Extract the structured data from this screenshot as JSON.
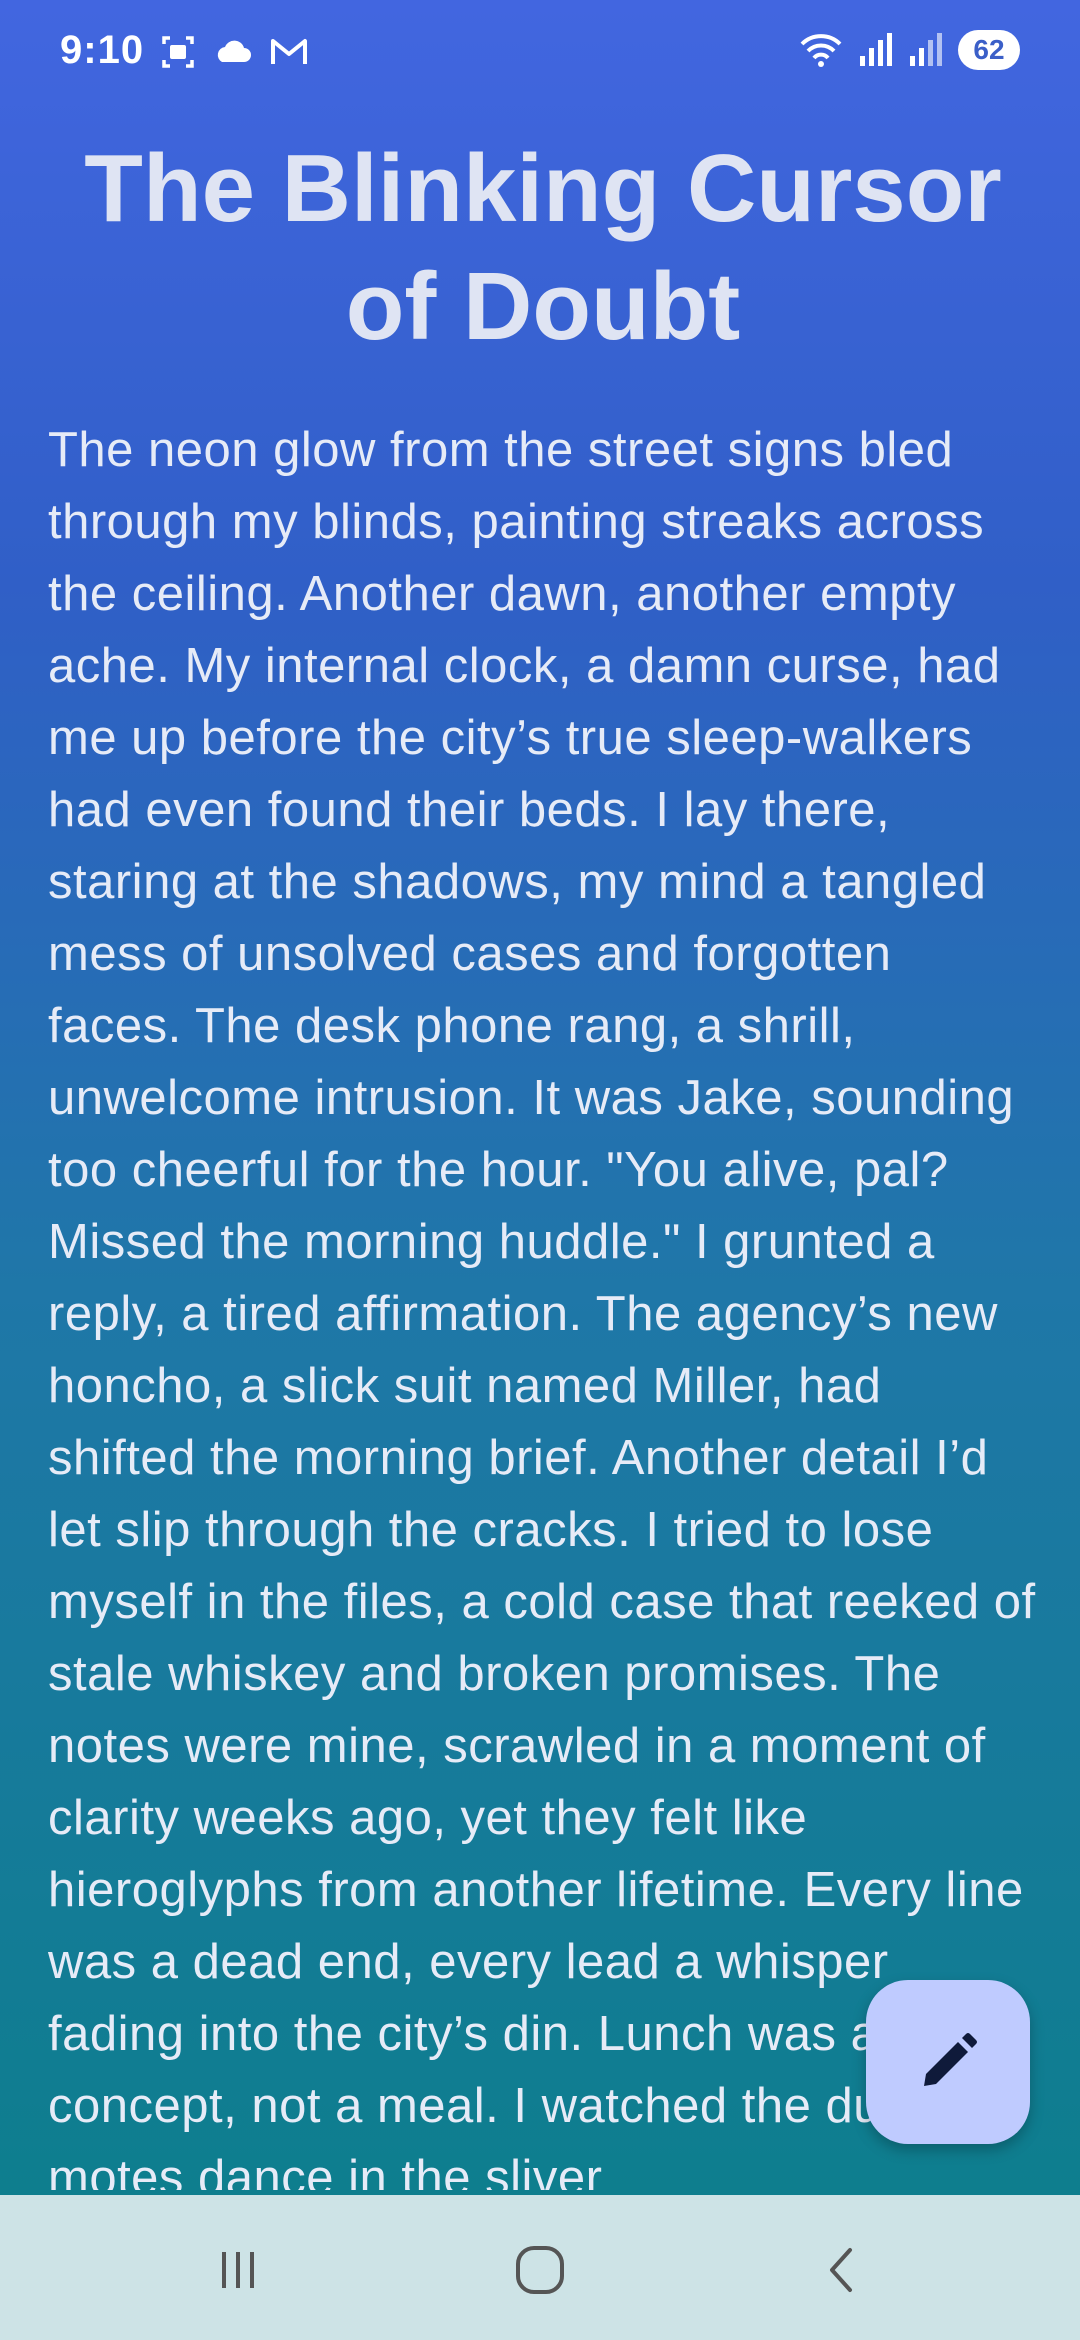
{
  "status_bar": {
    "time": "9:10",
    "battery": "62",
    "left_icons": [
      "screenshot-icon",
      "cloud-icon",
      "gmail-icon"
    ],
    "right_icons": [
      "wifi-icon",
      "signal-icon",
      "signal-icon-2"
    ]
  },
  "story": {
    "title": "The Blinking Cursor of Doubt",
    "body": "The neon glow from the street signs bled through my blinds, painting streaks across the ceiling. Another dawn, another empty ache. My internal clock, a damn curse, had me up before the city’s true sleep-walkers had even found their beds. I lay there, staring at the shadows, my mind a tangled mess of unsolved cases and forgotten faces. The desk phone rang, a shrill, unwelcome intrusion. It was Jake, sounding too cheerful for the hour. \"You alive, pal? Missed the morning huddle.\" I grunted a reply, a tired affirmation. The agency’s new honcho, a slick suit named Miller, had shifted the morning brief. Another detail I’d let slip through the cracks. I tried to lose myself in the files, a cold case that reeked of stale whiskey and broken promises. The notes were mine, scrawled in a moment of clarity weeks ago, yet they felt like hieroglyphs from another lifetime. Every line was a dead end, every lead a whisper fading into the city’s din. Lunch was a concept, not a meal. I watched the dust motes dance in the sliver"
  },
  "fab": {
    "icon": "pencil-icon"
  },
  "nav_bar": {
    "buttons": [
      "recents-button",
      "home-button",
      "back-button"
    ]
  },
  "colors": {
    "gradient_top": "#4266e0",
    "gradient_bottom": "#0b7f8a",
    "fab_background": "#bfcbff",
    "nav_background": "#cde3e6"
  }
}
